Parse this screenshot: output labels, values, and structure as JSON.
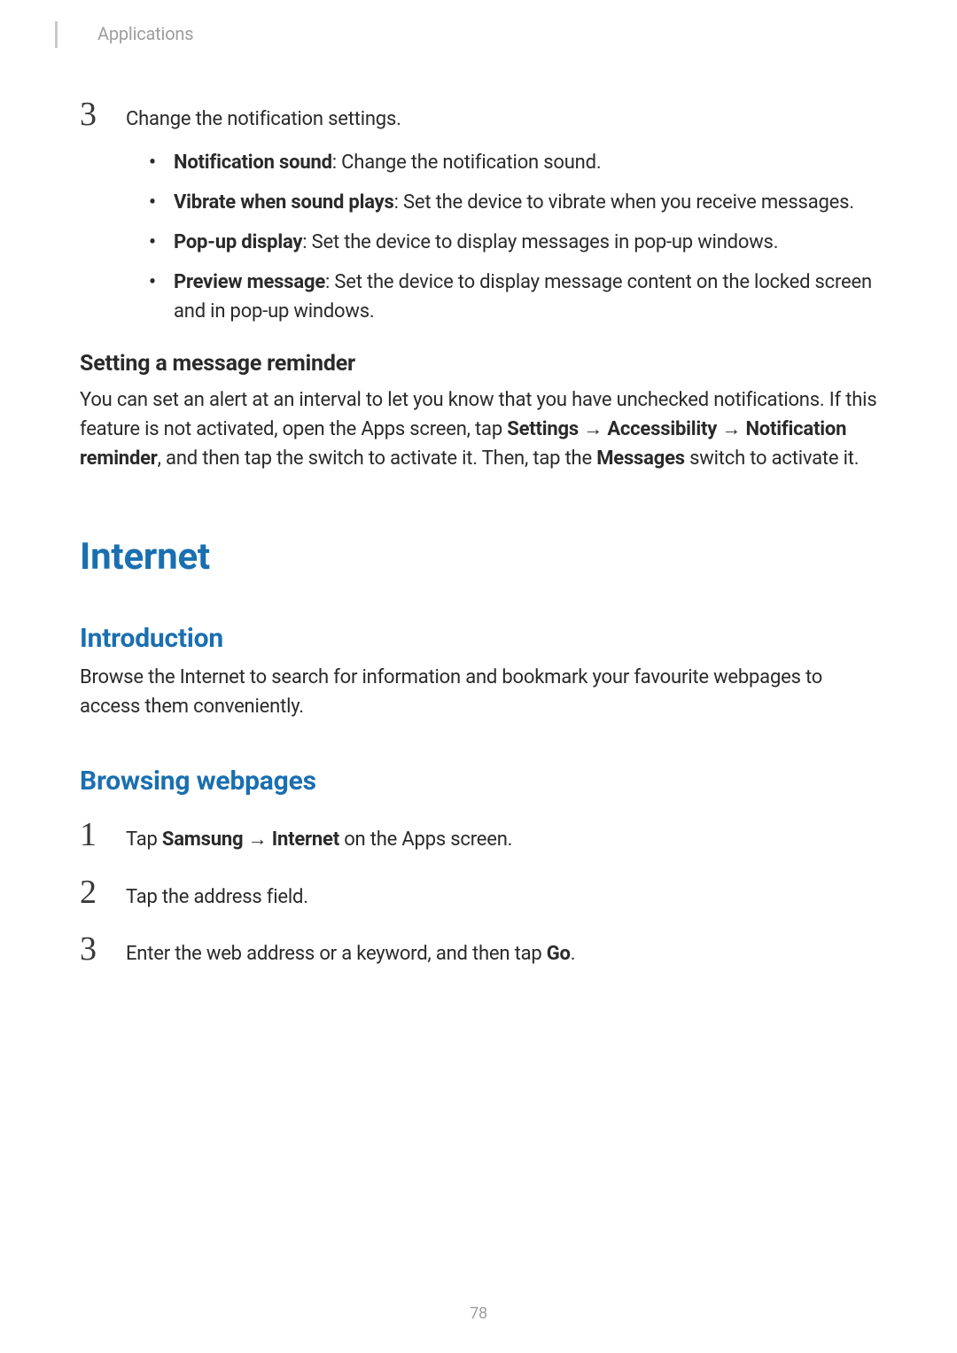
{
  "header": {
    "crumb": "Applications"
  },
  "step3": {
    "number": "3",
    "lead": "Change the notification settings.",
    "bullets": [
      {
        "term": "Notification sound",
        "desc": ": Change the notification sound."
      },
      {
        "term": "Vibrate when sound plays",
        "desc": ": Set the device to vibrate when you receive messages."
      },
      {
        "term": "Pop-up display",
        "desc": ": Set the device to display messages in pop-up windows."
      },
      {
        "term": "Preview message",
        "desc": ": Set the device to display message content on the locked screen and in pop-up windows."
      }
    ]
  },
  "reminder": {
    "heading": "Setting a message reminder",
    "p_pre": "You can set an alert at an interval to let you know that you have unchecked notifications. If this feature is not activated, open the Apps screen, tap ",
    "settings": "Settings",
    "arrow": "→",
    "accessibility": "Accessibility",
    "notif_reminder": "Notification reminder",
    "p_mid2": ", and then tap the switch to activate it. Then, tap the ",
    "messages": "Messages",
    "p_tail": " switch to activate it."
  },
  "internet": {
    "title": "Internet",
    "intro_h": "Introduction",
    "intro_p": "Browse the Internet to search for information and bookmark your favourite webpages to access them conveniently.",
    "browse_h": "Browsing webpages",
    "steps": {
      "s1": {
        "num": "1",
        "pre": "Tap ",
        "samsung": "Samsung",
        "arrow": "→",
        "internet": "Internet",
        "tail": " on the Apps screen."
      },
      "s2": {
        "num": "2",
        "text": "Tap the address field."
      },
      "s3": {
        "num": "3",
        "pre": "Enter the web address or a keyword, and then tap ",
        "go": "Go",
        "tail": "."
      }
    }
  },
  "pagenum": "78"
}
